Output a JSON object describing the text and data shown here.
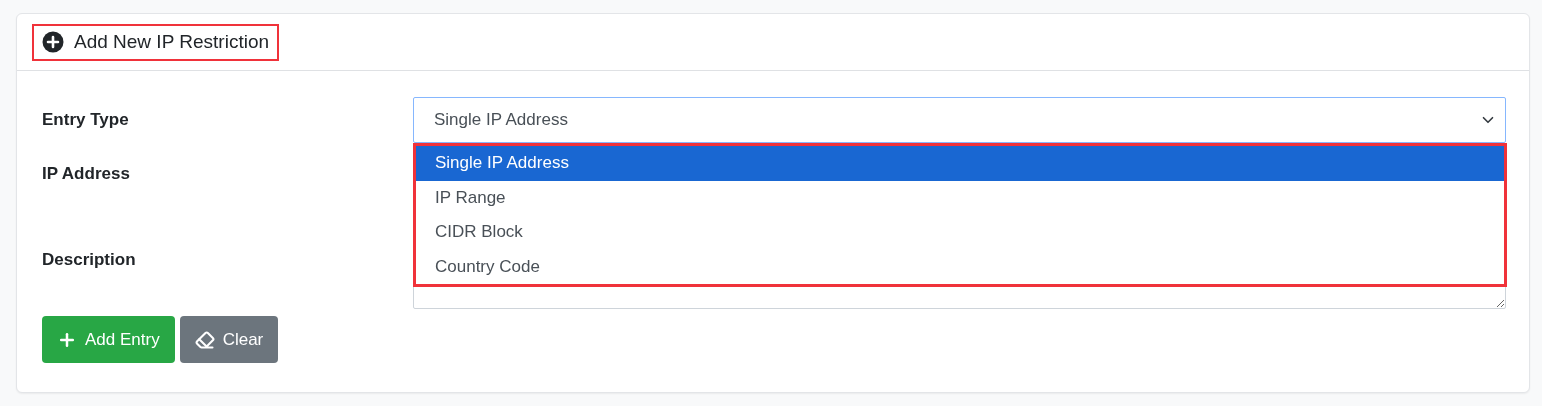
{
  "card": {
    "title": "Add New IP Restriction",
    "title_highlighted": true
  },
  "fields": [
    {
      "kind": "select",
      "label": "Entry Type",
      "value": "Single IP Address",
      "open": true,
      "list_highlighted": true,
      "options": [
        {
          "label": "Single IP Address",
          "selected": true
        },
        {
          "label": "IP Range",
          "selected": false
        },
        {
          "label": "CIDR Block",
          "selected": false
        },
        {
          "label": "Country Code",
          "selected": false
        }
      ]
    },
    {
      "kind": "covered",
      "label": "IP Address"
    },
    {
      "kind": "textarea",
      "label": "Description"
    }
  ],
  "buttons": [
    {
      "kind": "primary",
      "label": "Add Entry"
    },
    {
      "kind": "secondary",
      "label": "Clear"
    }
  ]
}
